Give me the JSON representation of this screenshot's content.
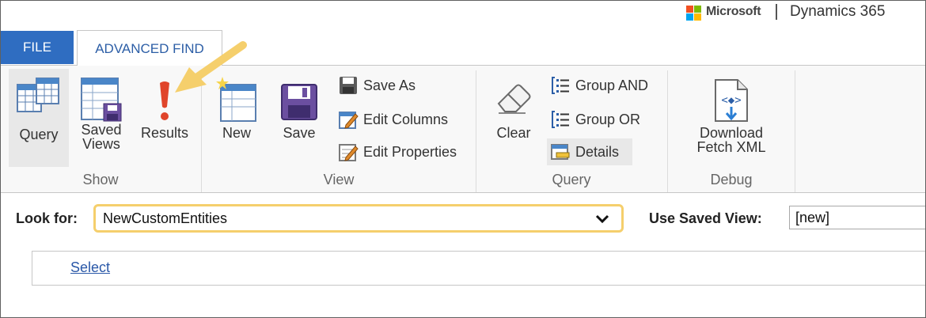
{
  "brand": {
    "company": "Microsoft",
    "product": "Dynamics 365",
    "logo_colors": [
      "#f25022",
      "#7fba00",
      "#00a4ef",
      "#ffb900"
    ]
  },
  "tabs": [
    {
      "label": "FILE",
      "active": false
    },
    {
      "label": "ADVANCED FIND",
      "active": true
    }
  ],
  "ribbon": {
    "groups": [
      {
        "label": "Show",
        "buttons": [
          {
            "label": "Query",
            "icon": "query-grid-icon",
            "selected": true
          },
          {
            "label": "Saved Views",
            "icon": "saved-views-icon"
          },
          {
            "label": "Results",
            "icon": "exclamation-icon"
          }
        ]
      },
      {
        "label": "View",
        "buttons": [
          {
            "label": "New",
            "icon": "new-view-icon"
          },
          {
            "label": "Save",
            "icon": "floppy-disk-icon"
          },
          {
            "label": "Save As",
            "icon": "save-as-icon"
          },
          {
            "label": "Edit Columns",
            "icon": "edit-columns-icon"
          },
          {
            "label": "Edit Properties",
            "icon": "edit-properties-icon"
          }
        ]
      },
      {
        "label": "Query",
        "buttons": [
          {
            "label": "Clear",
            "icon": "eraser-icon"
          },
          {
            "label": "Group AND",
            "icon": "group-and-icon"
          },
          {
            "label": "Group OR",
            "icon": "group-or-icon"
          },
          {
            "label": "Details",
            "icon": "details-icon"
          }
        ]
      },
      {
        "label": "Debug",
        "buttons": [
          {
            "label": "Download Fetch XML",
            "icon": "xml-document-icon"
          }
        ]
      }
    ]
  },
  "look_for": {
    "label": "Look for:",
    "value": "NewCustomEntities",
    "highlight_color": "#f5cf6c"
  },
  "saved_view": {
    "label": "Use Saved View:",
    "value": "[new]"
  },
  "criteria": {
    "select_link": "Select"
  },
  "annotation": {
    "arrow_color": "#f5cf6c",
    "points_to": "Results"
  }
}
